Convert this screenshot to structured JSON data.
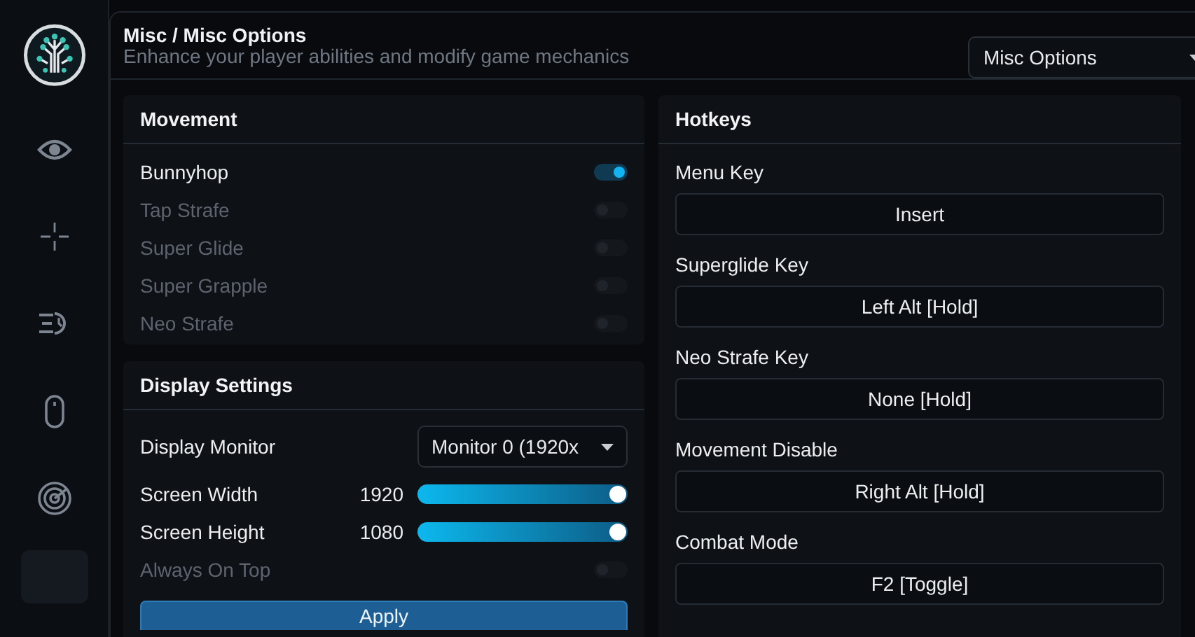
{
  "sidebar": {
    "items": [
      {
        "kind": "eye",
        "selected": false
      },
      {
        "kind": "crosshair",
        "selected": false
      },
      {
        "kind": "speed",
        "selected": false
      },
      {
        "kind": "mouse",
        "selected": false
      },
      {
        "kind": "radar",
        "selected": false
      },
      {
        "kind": "blank",
        "selected": true
      }
    ]
  },
  "header": {
    "title": "Misc / Misc Options",
    "subtitle": "Enhance your player abilities and modify game mechanics",
    "dropdown": "Misc Options"
  },
  "movement": {
    "title": "Movement",
    "toggles": [
      {
        "label": "Bunnyhop",
        "on": true
      },
      {
        "label": "Tap Strafe",
        "on": false
      },
      {
        "label": "Super Glide",
        "on": false
      },
      {
        "label": "Super Grapple",
        "on": false
      },
      {
        "label": "Neo Strafe",
        "on": false
      }
    ]
  },
  "display": {
    "title": "Display Settings",
    "rows": [
      {
        "kind": "select",
        "label": "Display Monitor",
        "value": "Monitor 0 (1920x"
      },
      {
        "kind": "slider",
        "label": "Screen Width",
        "reading": "1920",
        "level": 1
      },
      {
        "kind": "slider",
        "label": "Screen Height",
        "reading": "1080",
        "level": 1
      },
      {
        "kind": "toggle",
        "label": "Always On Top",
        "on": false
      }
    ],
    "button": "Apply"
  },
  "hotkeys": {
    "title": "Hotkeys",
    "keys": [
      {
        "label": "Menu Key",
        "value": "Insert"
      },
      {
        "label": "Superglide Key",
        "value": "Left Alt [Hold]"
      },
      {
        "label": "Neo Strafe Key",
        "value": "None [Hold]"
      },
      {
        "label": "Movement Disable",
        "value": "Right Alt [Hold]"
      },
      {
        "label": "Combat Mode",
        "value": "F2 [Toggle]"
      }
    ]
  }
}
